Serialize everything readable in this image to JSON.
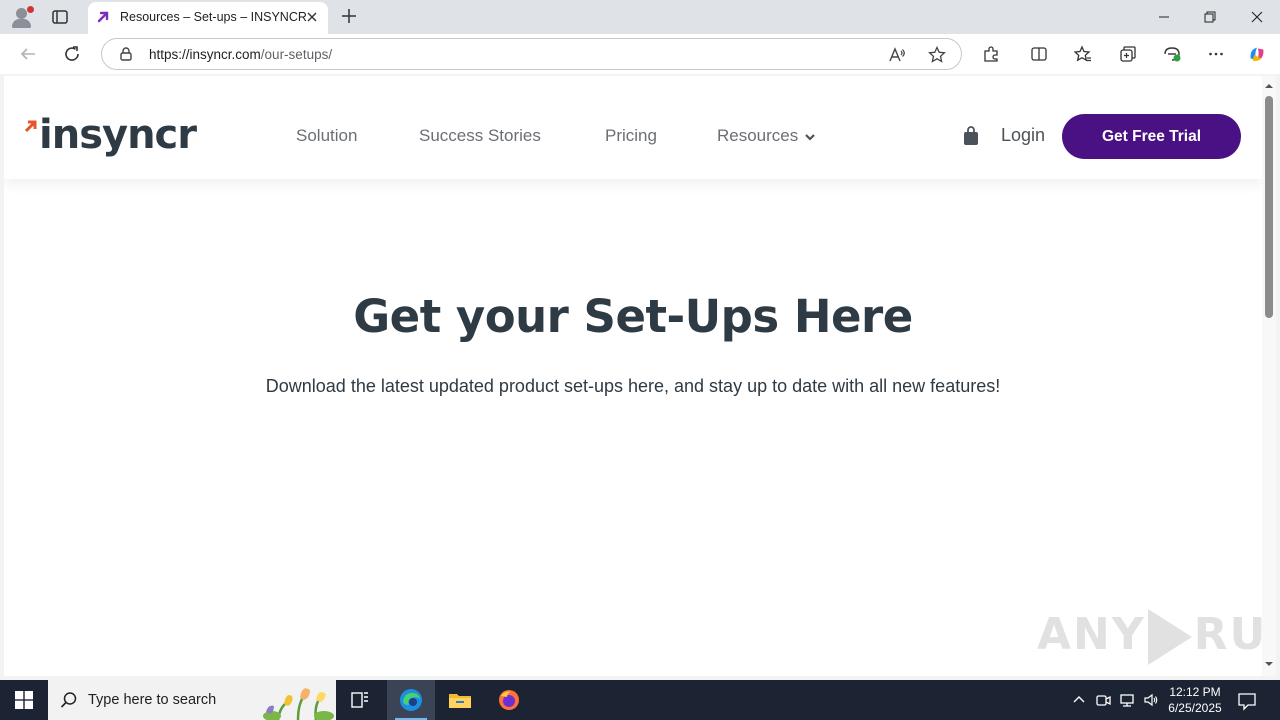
{
  "browser": {
    "tab_title": "Resources – Set-ups – INSYNCR",
    "url_host": "https://insyncr.com",
    "url_path": "/our-setups/"
  },
  "site": {
    "logo_text": "insyncr",
    "nav": [
      {
        "label": "Solution"
      },
      {
        "label": "Success Stories"
      },
      {
        "label": "Pricing"
      },
      {
        "label": "Resources"
      }
    ],
    "login_label": "Login",
    "cta_label": "Get Free Trial",
    "accent_color": "#4a1185",
    "text_color": "#2e3a44"
  },
  "hero": {
    "title": "Get your Set-Ups Here",
    "subtitle": "Download the latest updated product set-ups here, and stay up to date with all new features!"
  },
  "watermark": {
    "left": "ANY",
    "right": "RUN"
  },
  "taskbar": {
    "search_placeholder": "Type here to search",
    "time": "12:12 PM",
    "date": "6/25/2025"
  }
}
